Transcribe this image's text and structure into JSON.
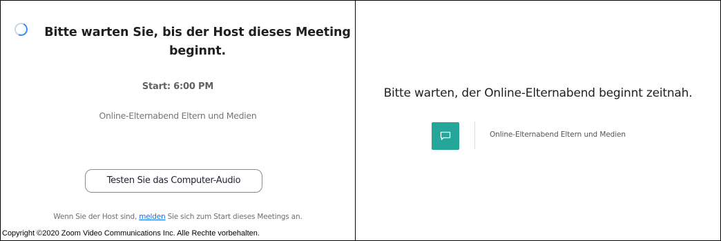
{
  "left_panel": {
    "waiting_title": "Bitte warten Sie, bis der Host dieses Meeting beginnt.",
    "start_time": "Start: 6:00 PM",
    "meeting_topic": "Online-Elternabend Eltern und Medien",
    "test_audio_button": "Testen Sie das Computer-Audio",
    "host_prefix": "Wenn Sie der Host sind,",
    "host_link": "melden",
    "host_suffix": "Sie sich zum Start dieses Meetings an.",
    "copyright": "Copyright ©2020 Zoom Video Communications Inc. Alle Rechte vorbehalten."
  },
  "right_panel": {
    "waiting_title": "Bitte warten, der Online-Elternabend beginnt zeitnah.",
    "meeting_topic": "Online-Elternabend Eltern und Medien",
    "chat_icon": "chat-bubble-icon"
  },
  "colors": {
    "spinner_accent": "#2d8cff",
    "link": "#0e72ed",
    "chat_tile": "#26a69a"
  }
}
